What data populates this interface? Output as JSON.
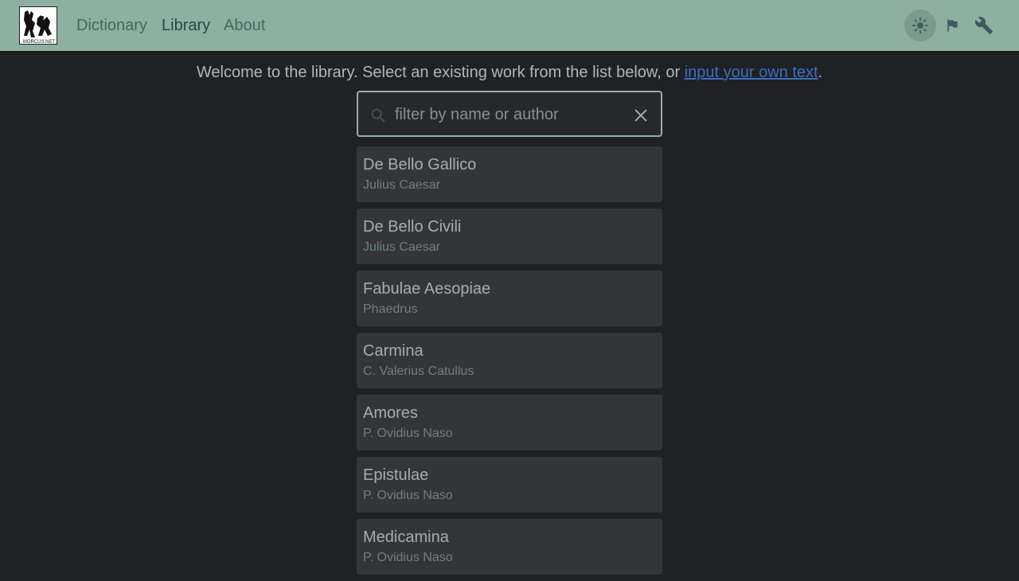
{
  "header": {
    "logo_text": "MORCUS.NET",
    "nav": [
      {
        "label": "Dictionary",
        "active": false
      },
      {
        "label": "Library",
        "active": true
      },
      {
        "label": "About",
        "active": false
      }
    ],
    "tools": [
      "sun-icon",
      "flag-icon",
      "wrench-icon"
    ]
  },
  "main": {
    "welcome_prefix": "Welcome to the library. Select an existing work from the list below, or ",
    "welcome_link": "input your own text",
    "welcome_suffix": ".",
    "search": {
      "placeholder": "filter by name or author",
      "value": ""
    },
    "works": [
      {
        "title": "De Bello Gallico",
        "author": "Julius Caesar"
      },
      {
        "title": "De Bello Civili",
        "author": "Julius Caesar"
      },
      {
        "title": "Fabulae Aesopiae",
        "author": "Phaedrus"
      },
      {
        "title": "Carmina",
        "author": "C. Valerius Catullus"
      },
      {
        "title": "Amores",
        "author": "P. Ovidius Naso"
      },
      {
        "title": "Epistulae",
        "author": "P. Ovidius Naso"
      },
      {
        "title": "Medicamina",
        "author": "P. Ovidius Naso"
      }
    ]
  },
  "colors": {
    "header_bg": "#8fafa0",
    "page_bg": "#202124",
    "card_bg": "#333538",
    "link": "#3a6fbf"
  }
}
